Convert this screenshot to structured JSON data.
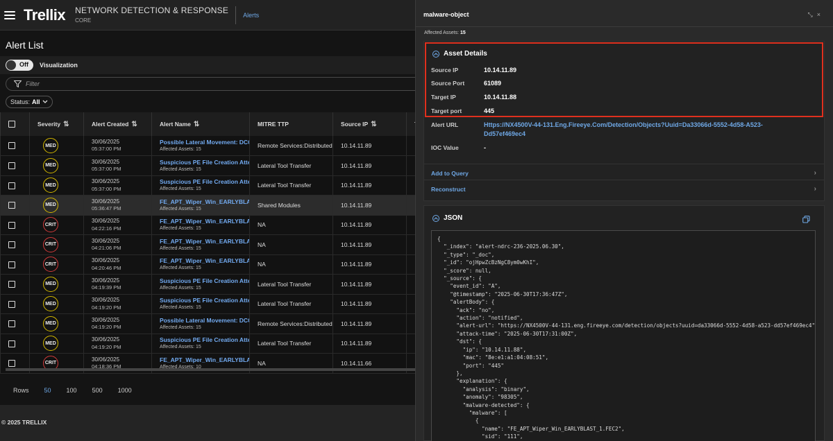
{
  "header": {
    "logo": "Trellix",
    "product_name": "NETWORK DETECTION & RESPONSE",
    "product_tier": "CORE",
    "breadcrumb": "Alerts"
  },
  "alert_list": {
    "title": "Alert List",
    "toggle_label": "Off",
    "visualization_label": "Visualization",
    "filter_placeholder": "Filter",
    "status_label": "Status:",
    "status_value": "All",
    "columns": [
      "Severity",
      "Alert Created",
      "Alert Name",
      "MITRE TTP",
      "Source IP",
      "T"
    ],
    "rows": [
      {
        "severity": "MED",
        "date": "30/06/2025",
        "time": "05:37:00 PM",
        "name": "Possible Lateral Movement: DCOM",
        "assets": "Affected Assets: 15",
        "ttp": "Remote Services:Distributed",
        "ip": "10.14.11.89",
        "highlight": false
      },
      {
        "severity": "MED",
        "date": "30/06/2025",
        "time": "05:37:00 PM",
        "name": "Suspicious PE File Creation Attempt",
        "assets": "Affected Assets: 15",
        "ttp": "Lateral Tool Transfer",
        "ip": "10.14.11.89",
        "highlight": false
      },
      {
        "severity": "MED",
        "date": "30/06/2025",
        "time": "05:37:00 PM",
        "name": "Suspicious PE File Creation Attempt",
        "assets": "Affected Assets: 15",
        "ttp": "Lateral Tool Transfer",
        "ip": "10.14.11.89",
        "highlight": false
      },
      {
        "severity": "MED",
        "date": "30/06/2025",
        "time": "05:36:47 PM",
        "name": "FE_APT_Wiper_Win_EARLYBLAST",
        "assets": "Affected Assets: 15",
        "ttp": "Shared Modules",
        "ip": "10.14.11.89",
        "highlight": true
      },
      {
        "severity": "CRIT",
        "date": "30/06/2025",
        "time": "04:22:16 PM",
        "name": "FE_APT_Wiper_Win_EARLYBLAST",
        "assets": "Affected Assets: 15",
        "ttp": "NA",
        "ip": "10.14.11.89",
        "highlight": false
      },
      {
        "severity": "CRIT",
        "date": "30/06/2025",
        "time": "04:21:06 PM",
        "name": "FE_APT_Wiper_Win_EARLYBLAST",
        "assets": "Affected Assets: 15",
        "ttp": "NA",
        "ip": "10.14.11.89",
        "highlight": false
      },
      {
        "severity": "CRIT",
        "date": "30/06/2025",
        "time": "04:20:46 PM",
        "name": "FE_APT_Wiper_Win_EARLYBLAST",
        "assets": "Affected Assets: 15",
        "ttp": "NA",
        "ip": "10.14.11.89",
        "highlight": false
      },
      {
        "severity": "MED",
        "date": "30/06/2025",
        "time": "04:19:39 PM",
        "name": "Suspicious PE File Creation Attempt",
        "assets": "Affected Assets: 15",
        "ttp": "Lateral Tool Transfer",
        "ip": "10.14.11.89",
        "highlight": false
      },
      {
        "severity": "MED",
        "date": "30/06/2025",
        "time": "04:19:20 PM",
        "name": "Suspicious PE File Creation Attempt",
        "assets": "Affected Assets: 15",
        "ttp": "Lateral Tool Transfer",
        "ip": "10.14.11.89",
        "highlight": false
      },
      {
        "severity": "MED",
        "date": "30/06/2025",
        "time": "04:19:20 PM",
        "name": "Possible Lateral Movement: DCOM",
        "assets": "Affected Assets: 15",
        "ttp": "Remote Services:Distributed",
        "ip": "10.14.11.89",
        "highlight": false
      },
      {
        "severity": "MED",
        "date": "30/06/2025",
        "time": "04:19:20 PM",
        "name": "Suspicious PE File Creation Attempt",
        "assets": "Affected Assets: 15",
        "ttp": "Lateral Tool Transfer",
        "ip": "10.14.11.89",
        "highlight": false
      },
      {
        "severity": "CRIT",
        "date": "30/06/2025",
        "time": "04:18:36 PM",
        "name": "FE_APT_Wiper_Win_EARLYBLAST",
        "assets": "Affected Assets: 10",
        "ttp": "NA",
        "ip": "10.14.11.66",
        "highlight": false
      }
    ],
    "rows_label": "Rows",
    "rows_options": [
      "50",
      "100",
      "500",
      "1000"
    ],
    "rows_selected": "50"
  },
  "footer": {
    "copyright": "© 2025 TRELLIX"
  },
  "panel": {
    "title": "malware-object",
    "affected_label": "Affected Assets:",
    "affected_value": "15",
    "asset_details": {
      "heading": "Asset Details",
      "source_ip_label": "Source IP",
      "source_ip": "10.14.11.89",
      "source_port_label": "Source Port",
      "source_port": "61089",
      "target_ip_label": "Target IP",
      "target_ip": "10.14.11.88",
      "target_port_label": "Target port",
      "target_port": "445",
      "alert_url_label": "Alert URL",
      "alert_url": "Https://NX4500V-44-131.Eng.Fireeye.Com/Detection/Objects?Uuid=Da33066d-5552-4d58-A523-Dd57ef469ec4",
      "ioc_label": "IOC Value",
      "ioc_value": "-"
    },
    "actions": [
      "Add to Query",
      "Reconstruct"
    ],
    "json_heading": "JSON",
    "json_text": "{\n  \"_index\": \"alert-ndrc-236-2025.06.30\",\n  \"_type\": \"_doc\",\n  \"_id\": \"ojHpwZcBzNgC8ym0wKhI\",\n  \"_score\": null,\n  \"_source\": {\n    \"event_id\": \"A\",\n    \"@timestamp\": \"2025-06-30T17:36:47Z\",\n    \"alertBody\": {\n      \"ack\": \"no\",\n      \"action\": \"notified\",\n      \"alert-url\": \"https://NX4500V-44-131.eng.fireeye.com/detection/objects?uuid=da33066d-5552-4d58-a523-dd57ef469ec4\",\n      \"attack-time\": \"2025-06-30T17:31:00Z\",\n      \"dst\": {\n        \"ip\": \"10.14.11.88\",\n        \"mac\": \"8e:e1:a1:04:08:51\",\n        \"port\": \"445\"\n      },\n      \"explanation\": {\n        \"analysis\": \"binary\",\n        \"anomaly\": \"98305\",\n        \"malware-detected\": {\n          \"malware\": [\n            {\n              \"name\": \"FE_APT_Wiper_Win_EARLYBLAST_1.FEC2\",\n              \"sid\": \"111\","
  },
  "colors": {
    "accent": "#6fa8e6",
    "med_ring": "#d4b800",
    "crit_ring": "#d43b3b",
    "highlight_box": "#e0301e"
  }
}
